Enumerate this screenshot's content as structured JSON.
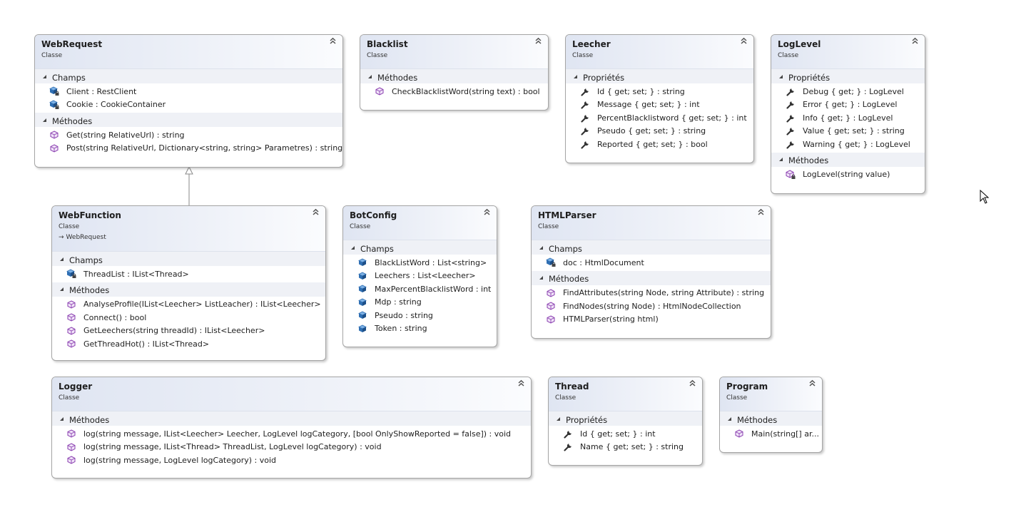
{
  "colors": {
    "header_start": "#dfe5f2",
    "section_bg": "#eff1f6",
    "border": "#a5a5a5",
    "method_icon": "#8a3fb0",
    "field_icon": "#2f6fb3",
    "property_icon": "#333333"
  },
  "classes": {
    "webrequest": {
      "name": "WebRequest",
      "kind": "Classe",
      "sections": [
        {
          "title": "Champs",
          "items": [
            {
              "icon": "field-private-icon",
              "text": "Client : RestClient"
            },
            {
              "icon": "field-private-icon",
              "text": "Cookie : CookieContainer"
            }
          ]
        },
        {
          "title": "Méthodes",
          "items": [
            {
              "icon": "method-icon",
              "text": "Get(string RelativeUrl) : string"
            },
            {
              "icon": "method-icon",
              "text": "Post(string RelativeUrl, Dictionary<string, string> Parametres) : string"
            }
          ]
        }
      ]
    },
    "blacklist": {
      "name": "Blacklist",
      "kind": "Classe",
      "sections": [
        {
          "title": "Méthodes",
          "items": [
            {
              "icon": "method-icon",
              "text": "CheckBlacklistWord(string text) : bool"
            }
          ]
        }
      ]
    },
    "leecher": {
      "name": "Leecher",
      "kind": "Classe",
      "sections": [
        {
          "title": "Propriétés",
          "items": [
            {
              "icon": "wrench-icon",
              "text": "Id { get; set; } : string"
            },
            {
              "icon": "wrench-icon",
              "text": "Message { get; set; } : int"
            },
            {
              "icon": "wrench-icon",
              "text": "PercentBlacklistword { get; set; } : int"
            },
            {
              "icon": "wrench-icon",
              "text": "Pseudo { get; set; } : string"
            },
            {
              "icon": "wrench-icon",
              "text": "Reported { get; set; } : bool"
            }
          ]
        }
      ]
    },
    "loglevel": {
      "name": "LogLevel",
      "kind": "Classe",
      "sections": [
        {
          "title": "Propriétés",
          "items": [
            {
              "icon": "wrench-icon",
              "text": "Debug { get; } : LogLevel"
            },
            {
              "icon": "wrench-icon",
              "text": "Error { get; } : LogLevel"
            },
            {
              "icon": "wrench-icon",
              "text": "Info { get; } : LogLevel"
            },
            {
              "icon": "wrench-icon",
              "text": "Value { get; set; } : string"
            },
            {
              "icon": "wrench-icon",
              "text": "Warning { get; } : LogLevel"
            }
          ]
        },
        {
          "title": "Méthodes",
          "items": [
            {
              "icon": "method-private-icon",
              "text": "LogLevel(string value)"
            }
          ]
        }
      ]
    },
    "webfunction": {
      "name": "WebFunction",
      "kind": "Classe",
      "inherits": "WebRequest",
      "sections": [
        {
          "title": "Champs",
          "items": [
            {
              "icon": "field-private-icon",
              "text": "ThreadList : IList<Thread>"
            }
          ]
        },
        {
          "title": "Méthodes",
          "items": [
            {
              "icon": "method-icon",
              "text": "AnalyseProfile(IList<Leecher> ListLeacher) : IList<Leecher>"
            },
            {
              "icon": "method-icon",
              "text": "Connect() : bool"
            },
            {
              "icon": "method-icon",
              "text": "GetLeechers(string threadId) : IList<Leecher>"
            },
            {
              "icon": "method-icon",
              "text": "GetThreadHot() : IList<Thread>"
            }
          ]
        }
      ]
    },
    "botconfig": {
      "name": "BotConfig",
      "kind": "Classe",
      "sections": [
        {
          "title": "Champs",
          "items": [
            {
              "icon": "field-icon",
              "text": "BlackListWord : List<string>"
            },
            {
              "icon": "field-icon",
              "text": "Leechers : List<Leecher>"
            },
            {
              "icon": "field-icon",
              "text": "MaxPercentBlacklistWord : int"
            },
            {
              "icon": "field-icon",
              "text": "Mdp : string"
            },
            {
              "icon": "field-icon",
              "text": "Pseudo : string"
            },
            {
              "icon": "field-icon",
              "text": "Token : string"
            }
          ]
        }
      ]
    },
    "htmlparser": {
      "name": "HTMLParser",
      "kind": "Classe",
      "sections": [
        {
          "title": "Champs",
          "items": [
            {
              "icon": "field-private-icon",
              "text": "doc : HtmlDocument"
            }
          ]
        },
        {
          "title": "Méthodes",
          "items": [
            {
              "icon": "method-icon",
              "text": "FindAttributes(string Node, string Attribute) : string"
            },
            {
              "icon": "method-icon",
              "text": "FindNodes(string Node) : HtmlNodeCollection"
            },
            {
              "icon": "method-icon",
              "text": "HTMLParser(string html)"
            }
          ]
        }
      ]
    },
    "logger": {
      "name": "Logger",
      "kind": "Classe",
      "sections": [
        {
          "title": "Méthodes",
          "items": [
            {
              "icon": "method-icon",
              "text": "log(string message, IList<Leecher> Leecher, LogLevel logCategory, [bool OnlyShowReported = false]) : void"
            },
            {
              "icon": "method-icon",
              "text": "log(string message, IList<Thread> ThreadList, LogLevel logCategory) : void"
            },
            {
              "icon": "method-icon",
              "text": "log(string message, LogLevel logCategory) : void"
            }
          ]
        }
      ]
    },
    "thread": {
      "name": "Thread",
      "kind": "Classe",
      "sections": [
        {
          "title": "Propriétés",
          "items": [
            {
              "icon": "wrench-icon",
              "text": "Id { get; set; } : int"
            },
            {
              "icon": "wrench-icon",
              "text": "Name { get; set; } : string"
            }
          ]
        }
      ]
    },
    "program": {
      "name": "Program",
      "kind": "Classe",
      "sections": [
        {
          "title": "Méthodes",
          "items": [
            {
              "icon": "method-icon",
              "text": "Main(string[] ar..."
            }
          ]
        }
      ]
    }
  }
}
